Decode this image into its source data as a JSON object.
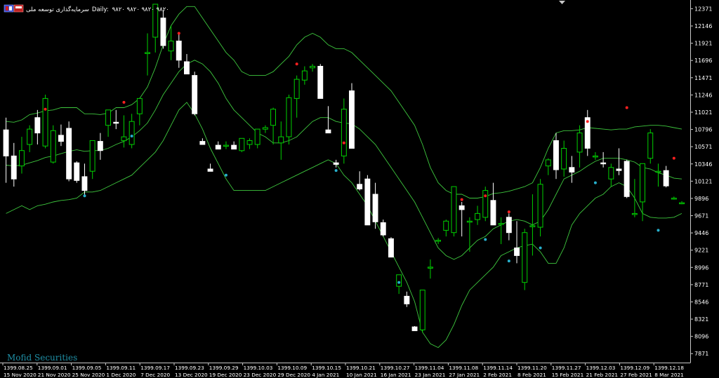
{
  "header": {
    "symbol_label": "سرمایه‌گذاری توسعه ملی",
    "timeframe_label": "Daily:",
    "ohlc_text": "۹۸۲۰ ۹۸۲۰ ۹۸۲۰ ۹۸۲۰"
  },
  "watermark": "Mofid Securities",
  "colors": {
    "background": "#000000",
    "axis": "#c8c8c8",
    "text": "#ffffff",
    "bull_body": "#000000",
    "bull_border": "#00d000",
    "bear_body": "#ffffff",
    "bear_border": "#ffffff",
    "wick": "#00d000",
    "bands": "#3ec83e",
    "dot_high": "#ff2020",
    "dot_low": "#27b0cc",
    "watermark": "#1f8fa6"
  },
  "chart_data": {
    "type": "candlestick",
    "y_axis_labels": [
      "12371",
      "12146",
      "11921",
      "11696",
      "11471",
      "11246",
      "11021",
      "10796",
      "10571",
      "10346",
      "10121",
      "9896",
      "9671",
      "9446",
      "9221",
      "8996",
      "8771",
      "8546",
      "8321",
      "8096",
      "7871"
    ],
    "ylim": [
      7800,
      12430
    ],
    "x_axis_row1": [
      "1399.08.25",
      "1399.09.01",
      "1399.09.05",
      "1399.09.11",
      "1399.09.17",
      "1399.09.23",
      "1399.09.29",
      "1399.10.03",
      "1399.10.09",
      "1399.10.15",
      "1399.10.21",
      "1399.10.27",
      "1399.11.04",
      "1399.11.08",
      "1399.11.14",
      "1399.11.20",
      "1399.11.27",
      "1399.12.03",
      "1399.12.09",
      "1399.12.18"
    ],
    "x_axis_row2": [
      "15 Nov 2020",
      "21 Nov 2020",
      "25 Nov 2020",
      "1 Dec 2020",
      "7 Dec 2020",
      "13 Dec 2020",
      "19 Dec 2020",
      "23 Dec 2020",
      "29 Dec 2020",
      "4 Jan 2021",
      "10 Jan 2021",
      "16 Jan 2021",
      "23 Jan 2021",
      "27 Jan 2021",
      "2 Feb 2021",
      "8 Feb 2021",
      "15 Feb 2021",
      "21 Feb 2021",
      "27 Feb 2021",
      "8 Mar 2021"
    ],
    "bar_spacing_days": 1,
    "candles": [
      {
        "o": 10790,
        "h": 10950,
        "l": 10100,
        "c": 10450
      },
      {
        "o": 10450,
        "h": 10620,
        "l": 10050,
        "c": 10150
      },
      {
        "o": 10320,
        "h": 10700,
        "l": 10220,
        "c": 10520
      },
      {
        "o": 10600,
        "h": 10850,
        "l": 10500,
        "c": 10800
      },
      {
        "o": 10950,
        "h": 11050,
        "l": 10600,
        "c": 10750
      },
      {
        "o": 10580,
        "h": 11250,
        "l": 10550,
        "c": 11200
      },
      {
        "o": 10370,
        "h": 10850,
        "l": 10350,
        "c": 10780
      },
      {
        "o": 10720,
        "h": 10860,
        "l": 10580,
        "c": 10640
      },
      {
        "o": 10810,
        "h": 10900,
        "l": 10120,
        "c": 10150
      },
      {
        "o": 10360,
        "h": 10380,
        "l": 10100,
        "c": 10130
      },
      {
        "o": 10180,
        "h": 10350,
        "l": 9930,
        "c": 10000
      },
      {
        "o": 10250,
        "h": 10650,
        "l": 10150,
        "c": 10650
      },
      {
        "o": 10640,
        "h": 10750,
        "l": 10400,
        "c": 10520
      },
      {
        "o": 10850,
        "h": 11000,
        "l": 10700,
        "c": 11050
      },
      {
        "o": 10890,
        "h": 11050,
        "l": 10800,
        "c": 10880
      },
      {
        "o": 10650,
        "h": 10980,
        "l": 10560,
        "c": 10700
      },
      {
        "o": 10600,
        "h": 11000,
        "l": 10550,
        "c": 10900
      },
      {
        "o": 11000,
        "h": 11150,
        "l": 10850,
        "c": 11200
      },
      {
        "o": 11800,
        "h": 12050,
        "l": 11500,
        "c": 11800
      },
      {
        "o": 12000,
        "h": 12430,
        "l": 11800,
        "c": 12430
      },
      {
        "o": 12250,
        "h": 12350,
        "l": 11850,
        "c": 11890
      },
      {
        "o": 11820,
        "h": 12150,
        "l": 11700,
        "c": 11950
      },
      {
        "o": 11950,
        "h": 12050,
        "l": 11600,
        "c": 11700
      },
      {
        "o": 11680,
        "h": 11780,
        "l": 11520,
        "c": 11520
      },
      {
        "o": 11500,
        "h": 11550,
        "l": 10980,
        "c": 11000
      },
      {
        "o": 10640,
        "h": 10680,
        "l": 10600,
        "c": 10600
      },
      {
        "o": 10280,
        "h": 10350,
        "l": 10250,
        "c": 10250
      },
      {
        "o": 10590,
        "h": 10640,
        "l": 10540,
        "c": 10540
      },
      {
        "o": 10590,
        "h": 10640,
        "l": 10540,
        "c": 10590
      },
      {
        "o": 10590,
        "h": 10640,
        "l": 10540,
        "c": 10540
      },
      {
        "o": 10520,
        "h": 10680,
        "l": 10500,
        "c": 10680
      },
      {
        "o": 10600,
        "h": 10680,
        "l": 10540,
        "c": 10650
      },
      {
        "o": 10600,
        "h": 10800,
        "l": 10550,
        "c": 10800
      },
      {
        "o": 10800,
        "h": 10850,
        "l": 10750,
        "c": 10820
      },
      {
        "o": 10850,
        "h": 11080,
        "l": 10600,
        "c": 11060
      },
      {
        "o": 10620,
        "h": 10900,
        "l": 10400,
        "c": 10700
      },
      {
        "o": 10700,
        "h": 11250,
        "l": 10600,
        "c": 11210
      },
      {
        "o": 11200,
        "h": 11500,
        "l": 10950,
        "c": 11450
      },
      {
        "o": 11440,
        "h": 11620,
        "l": 11380,
        "c": 11560
      },
      {
        "o": 11600,
        "h": 11650,
        "l": 11550,
        "c": 11620
      },
      {
        "o": 11620,
        "h": 11650,
        "l": 11200,
        "c": 11200
      },
      {
        "o": 10790,
        "h": 11100,
        "l": 10750,
        "c": 10750
      },
      {
        "o": 10360,
        "h": 10400,
        "l": 10300,
        "c": 10340
      },
      {
        "o": 10450,
        "h": 11200,
        "l": 10350,
        "c": 11060
      },
      {
        "o": 11300,
        "h": 11400,
        "l": 10550,
        "c": 10550
      },
      {
        "o": 10080,
        "h": 10250,
        "l": 10000,
        "c": 10020
      },
      {
        "o": 10150,
        "h": 10200,
        "l": 9550,
        "c": 9550
      },
      {
        "o": 9950,
        "h": 10100,
        "l": 9500,
        "c": 9590
      },
      {
        "o": 9580,
        "h": 9620,
        "l": 9400,
        "c": 9420
      },
      {
        "o": 9370,
        "h": 9390,
        "l": 9130,
        "c": 9130
      },
      {
        "o": 8750,
        "h": 8900,
        "l": 8650,
        "c": 8900
      },
      {
        "o": 8620,
        "h": 8680,
        "l": 8480,
        "c": 8520
      },
      {
        "o": 8220,
        "h": 8230,
        "l": 8200,
        "c": 8170
      },
      {
        "o": 8180,
        "h": 8700,
        "l": 8150,
        "c": 8700
      },
      {
        "o": 9000,
        "h": 9100,
        "l": 8850,
        "c": 9000
      },
      {
        "o": 9340,
        "h": 9380,
        "l": 9300,
        "c": 9350
      },
      {
        "o": 9480,
        "h": 9620,
        "l": 9400,
        "c": 9600
      },
      {
        "o": 9450,
        "h": 10050,
        "l": 9400,
        "c": 10050
      },
      {
        "o": 9800,
        "h": 9850,
        "l": 9400,
        "c": 9750
      },
      {
        "o": 9600,
        "h": 9650,
        "l": 9200,
        "c": 9600
      },
      {
        "o": 9620,
        "h": 9800,
        "l": 9550,
        "c": 9700
      },
      {
        "o": 9650,
        "h": 10050,
        "l": 9600,
        "c": 10000
      },
      {
        "o": 9870,
        "h": 10100,
        "l": 9600,
        "c": 9550
      },
      {
        "o": 9570,
        "h": 9650,
        "l": 9300,
        "c": 9570
      },
      {
        "o": 9650,
        "h": 9700,
        "l": 9350,
        "c": 9450
      },
      {
        "o": 9250,
        "h": 9600,
        "l": 9050,
        "c": 9150
      },
      {
        "o": 8800,
        "h": 9500,
        "l": 8700,
        "c": 9450
      },
      {
        "o": 9540,
        "h": 9950,
        "l": 9150,
        "c": 9540
      },
      {
        "o": 9520,
        "h": 10150,
        "l": 9400,
        "c": 10080
      },
      {
        "o": 10320,
        "h": 10420,
        "l": 10200,
        "c": 10400
      },
      {
        "o": 10650,
        "h": 10750,
        "l": 10150,
        "c": 10270
      },
      {
        "o": 10280,
        "h": 10650,
        "l": 10180,
        "c": 10550
      },
      {
        "o": 10300,
        "h": 10450,
        "l": 10100,
        "c": 10240
      },
      {
        "o": 10500,
        "h": 10850,
        "l": 10300,
        "c": 10750
      },
      {
        "o": 10950,
        "h": 11050,
        "l": 10450,
        "c": 10550
      },
      {
        "o": 10450,
        "h": 10500,
        "l": 10400,
        "c": 10450
      },
      {
        "o": 10360,
        "h": 10500,
        "l": 10300,
        "c": 10350
      },
      {
        "o": 10150,
        "h": 10350,
        "l": 10050,
        "c": 10300
      },
      {
        "o": 10280,
        "h": 10550,
        "l": 10200,
        "c": 10260
      },
      {
        "o": 10380,
        "h": 10400,
        "l": 9900,
        "c": 9920
      },
      {
        "o": 9700,
        "h": 10150,
        "l": 9650,
        "c": 9700
      },
      {
        "o": 9850,
        "h": 10350,
        "l": 9600,
        "c": 10350
      },
      {
        "o": 10420,
        "h": 10800,
        "l": 10350,
        "c": 10750
      },
      {
        "o": 10250,
        "h": 10350,
        "l": 10050,
        "c": 10250
      },
      {
        "o": 10260,
        "h": 10320,
        "l": 10040,
        "c": 10060
      },
      {
        "o": 9900,
        "h": 9920,
        "l": 9880,
        "c": 9900
      },
      {
        "o": 9840,
        "h": 9860,
        "l": 9820,
        "c": 9840
      }
    ],
    "bb_upper": [
      10900,
      10890,
      10920,
      10990,
      11010,
      11040,
      11050,
      11080,
      11080,
      11080,
      11000,
      11000,
      10990,
      11010,
      11080,
      11080,
      11120,
      11200,
      11350,
      11600,
      11900,
      12150,
      12300,
      12400,
      12400,
      12250,
      12100,
      11950,
      11800,
      11700,
      11550,
      11500,
      11500,
      11500,
      11550,
      11650,
      11750,
      11900,
      12000,
      12050,
      12000,
      11900,
      11850,
      11850,
      11800,
      11700,
      11600,
      11500,
      11400,
      11300,
      11150,
      11000,
      10850,
      10600,
      10300,
      10100,
      10000,
      9950,
      9950,
      9900,
      9900,
      9920,
      9960,
      9970,
      9990,
      10020,
      10050,
      10100,
      10300,
      10550,
      10750,
      10780,
      10780,
      10790,
      10820,
      10810,
      10800,
      10790,
      10800,
      10800,
      10830,
      10840,
      10850,
      10850,
      10840,
      10820,
      10800
    ],
    "bb_middle": [
      10330,
      10320,
      10330,
      10360,
      10390,
      10430,
      10450,
      10480,
      10510,
      10530,
      10510,
      10520,
      10520,
      10550,
      10600,
      10640,
      10700,
      10780,
      10880,
      11050,
      11250,
      11400,
      11550,
      11650,
      11700,
      11650,
      11550,
      11400,
      11200,
      11050,
      10950,
      10850,
      10750,
      10700,
      10620,
      10620,
      10650,
      10700,
      10800,
      10900,
      10950,
      10950,
      10900,
      10880,
      10870,
      10800,
      10700,
      10600,
      10450,
      10300,
      10150,
      10000,
      9850,
      9650,
      9450,
      9250,
      9150,
      9100,
      9150,
      9250,
      9350,
      9400,
      9500,
      9550,
      9600,
      9620,
      9600,
      9550,
      9600,
      9750,
      9950,
      10150,
      10200,
      10250,
      10320,
      10380,
      10420,
      10420,
      10420,
      10400,
      10370,
      10300,
      10280,
      10230,
      10200,
      10160,
      10150
    ],
    "bb_lower": [
      9700,
      9750,
      9800,
      9750,
      9800,
      9820,
      9850,
      9870,
      9880,
      9900,
      9980,
      9980,
      10000,
      10050,
      10100,
      10150,
      10200,
      10300,
      10400,
      10500,
      10650,
      10850,
      11050,
      11150,
      11000,
      10800,
      10550,
      10350,
      10150,
      10000,
      10000,
      10000,
      10000,
      10000,
      10050,
      10100,
      10150,
      10200,
      10250,
      10300,
      10350,
      10400,
      10350,
      10200,
      10100,
      9950,
      9800,
      9600,
      9400,
      9200,
      9000,
      8800,
      8550,
      8150,
      8000,
      7950,
      8050,
      8250,
      8500,
      8700,
      8800,
      8900,
      9000,
      9150,
      9200,
      9250,
      9280,
      9300,
      9200,
      9050,
      9050,
      9250,
      9550,
      9700,
      9800,
      9900,
      9950,
      10050,
      10100,
      10050,
      9900,
      9700,
      9650,
      9640,
      9640,
      9650,
      9700
    ],
    "fractals_high": [
      {
        "i": 5,
        "v": 11060
      },
      {
        "i": 15,
        "v": 11150
      },
      {
        "i": 22,
        "v": 12050
      },
      {
        "i": 37,
        "v": 11650
      },
      {
        "i": 43,
        "v": 10620
      },
      {
        "i": 58,
        "v": 9880
      },
      {
        "i": 61,
        "v": 9930
      },
      {
        "i": 64,
        "v": 9720
      },
      {
        "i": 74,
        "v": 10900
      },
      {
        "i": 79,
        "v": 11080
      },
      {
        "i": 85,
        "v": 10420
      }
    ],
    "fractals_low": [
      {
        "i": 10,
        "v": 9930
      },
      {
        "i": 16,
        "v": 10710
      },
      {
        "i": 28,
        "v": 10200
      },
      {
        "i": 42,
        "v": 10260
      },
      {
        "i": 50,
        "v": 8800
      },
      {
        "i": 61,
        "v": 9360
      },
      {
        "i": 64,
        "v": 9080
      },
      {
        "i": 68,
        "v": 9250
      },
      {
        "i": 75,
        "v": 10100
      },
      {
        "i": 83,
        "v": 9480
      }
    ]
  }
}
